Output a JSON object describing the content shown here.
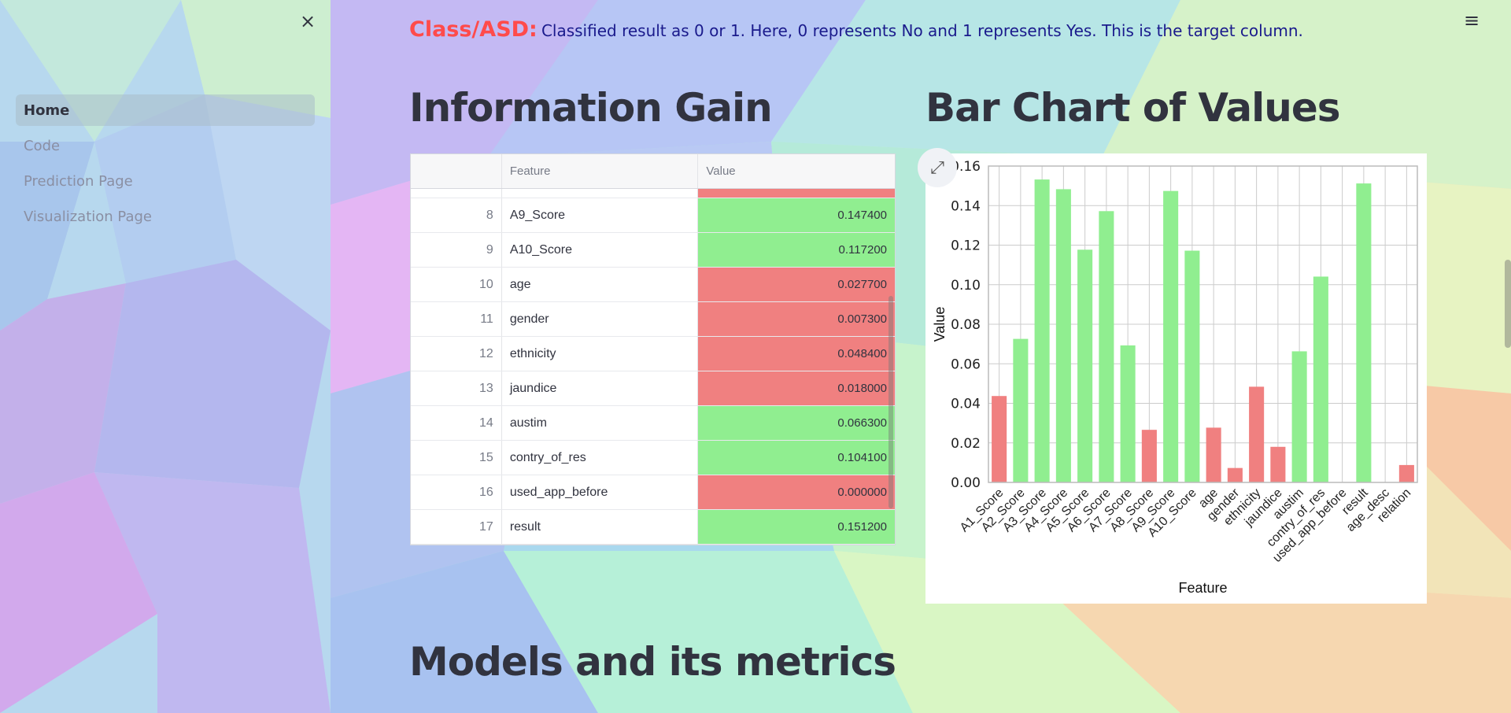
{
  "sidebar": {
    "close_glyph": "×",
    "items": [
      {
        "label": "Home",
        "active": true
      },
      {
        "label": "Code",
        "active": false
      },
      {
        "label": "Prediction Page",
        "active": false
      },
      {
        "label": "Visualization Page",
        "active": false
      }
    ]
  },
  "header": {
    "menu_glyph": "≡",
    "class_label": "Class/ASD:",
    "class_description": "Classified result as 0 or 1. Here, 0 represents No and 1 represents Yes. This is the target column."
  },
  "section_info_gain": {
    "title": "Information Gain",
    "table": {
      "columns": [
        "",
        "Feature",
        "Value"
      ],
      "rows": [
        {
          "index": "8",
          "feature": "A9_Score",
          "value": "0.147400",
          "status": "green"
        },
        {
          "index": "9",
          "feature": "A10_Score",
          "value": "0.117200",
          "status": "green"
        },
        {
          "index": "10",
          "feature": "age",
          "value": "0.027700",
          "status": "red"
        },
        {
          "index": "11",
          "feature": "gender",
          "value": "0.007300",
          "status": "red"
        },
        {
          "index": "12",
          "feature": "ethnicity",
          "value": "0.048400",
          "status": "red"
        },
        {
          "index": "13",
          "feature": "jaundice",
          "value": "0.018000",
          "status": "red"
        },
        {
          "index": "14",
          "feature": "austim",
          "value": "0.066300",
          "status": "green"
        },
        {
          "index": "15",
          "feature": "contry_of_res",
          "value": "0.104100",
          "status": "green"
        },
        {
          "index": "16",
          "feature": "used_app_before",
          "value": "0.000000",
          "status": "red"
        },
        {
          "index": "17",
          "feature": "result",
          "value": "0.151200",
          "status": "green"
        }
      ]
    }
  },
  "section_bar_chart": {
    "title": "Bar Chart of Values",
    "expand_glyph": "⤢"
  },
  "section_models": {
    "title": "Models and its metrics"
  },
  "colors": {
    "red": "#f08080",
    "green": "#90ee90",
    "accent": "#ff4b4b",
    "class_text": "#1a1a8c"
  },
  "chart_data": {
    "type": "bar",
    "xlabel": "Feature",
    "ylabel": "Value",
    "ylim": [
      0,
      0.16
    ],
    "yticks": [
      "0.00",
      "0.02",
      "0.04",
      "0.06",
      "0.08",
      "0.10",
      "0.12",
      "0.14",
      "0.16"
    ],
    "grid": true,
    "categories": [
      "A1_Score",
      "A2_Score",
      "A3_Score",
      "A4_Score",
      "A5_Score",
      "A6_Score",
      "A7_Score",
      "A8_Score",
      "A9_Score",
      "A10_Score",
      "age",
      "gender",
      "ethnicity",
      "jaundice",
      "austim",
      "contry_of_res",
      "used_app_before",
      "result",
      "age_desc",
      "relation"
    ],
    "values": [
      0.0437,
      0.0726,
      0.1532,
      0.1483,
      0.1177,
      0.1372,
      0.0693,
      0.0266,
      0.1474,
      0.1172,
      0.0277,
      0.0073,
      0.0484,
      0.018,
      0.0663,
      0.1041,
      0.0,
      0.1512,
      0.0,
      0.0088
    ],
    "colors": [
      "red",
      "green",
      "green",
      "green",
      "green",
      "green",
      "green",
      "red",
      "green",
      "green",
      "red",
      "red",
      "red",
      "red",
      "green",
      "green",
      "red",
      "green",
      "red",
      "red"
    ]
  }
}
